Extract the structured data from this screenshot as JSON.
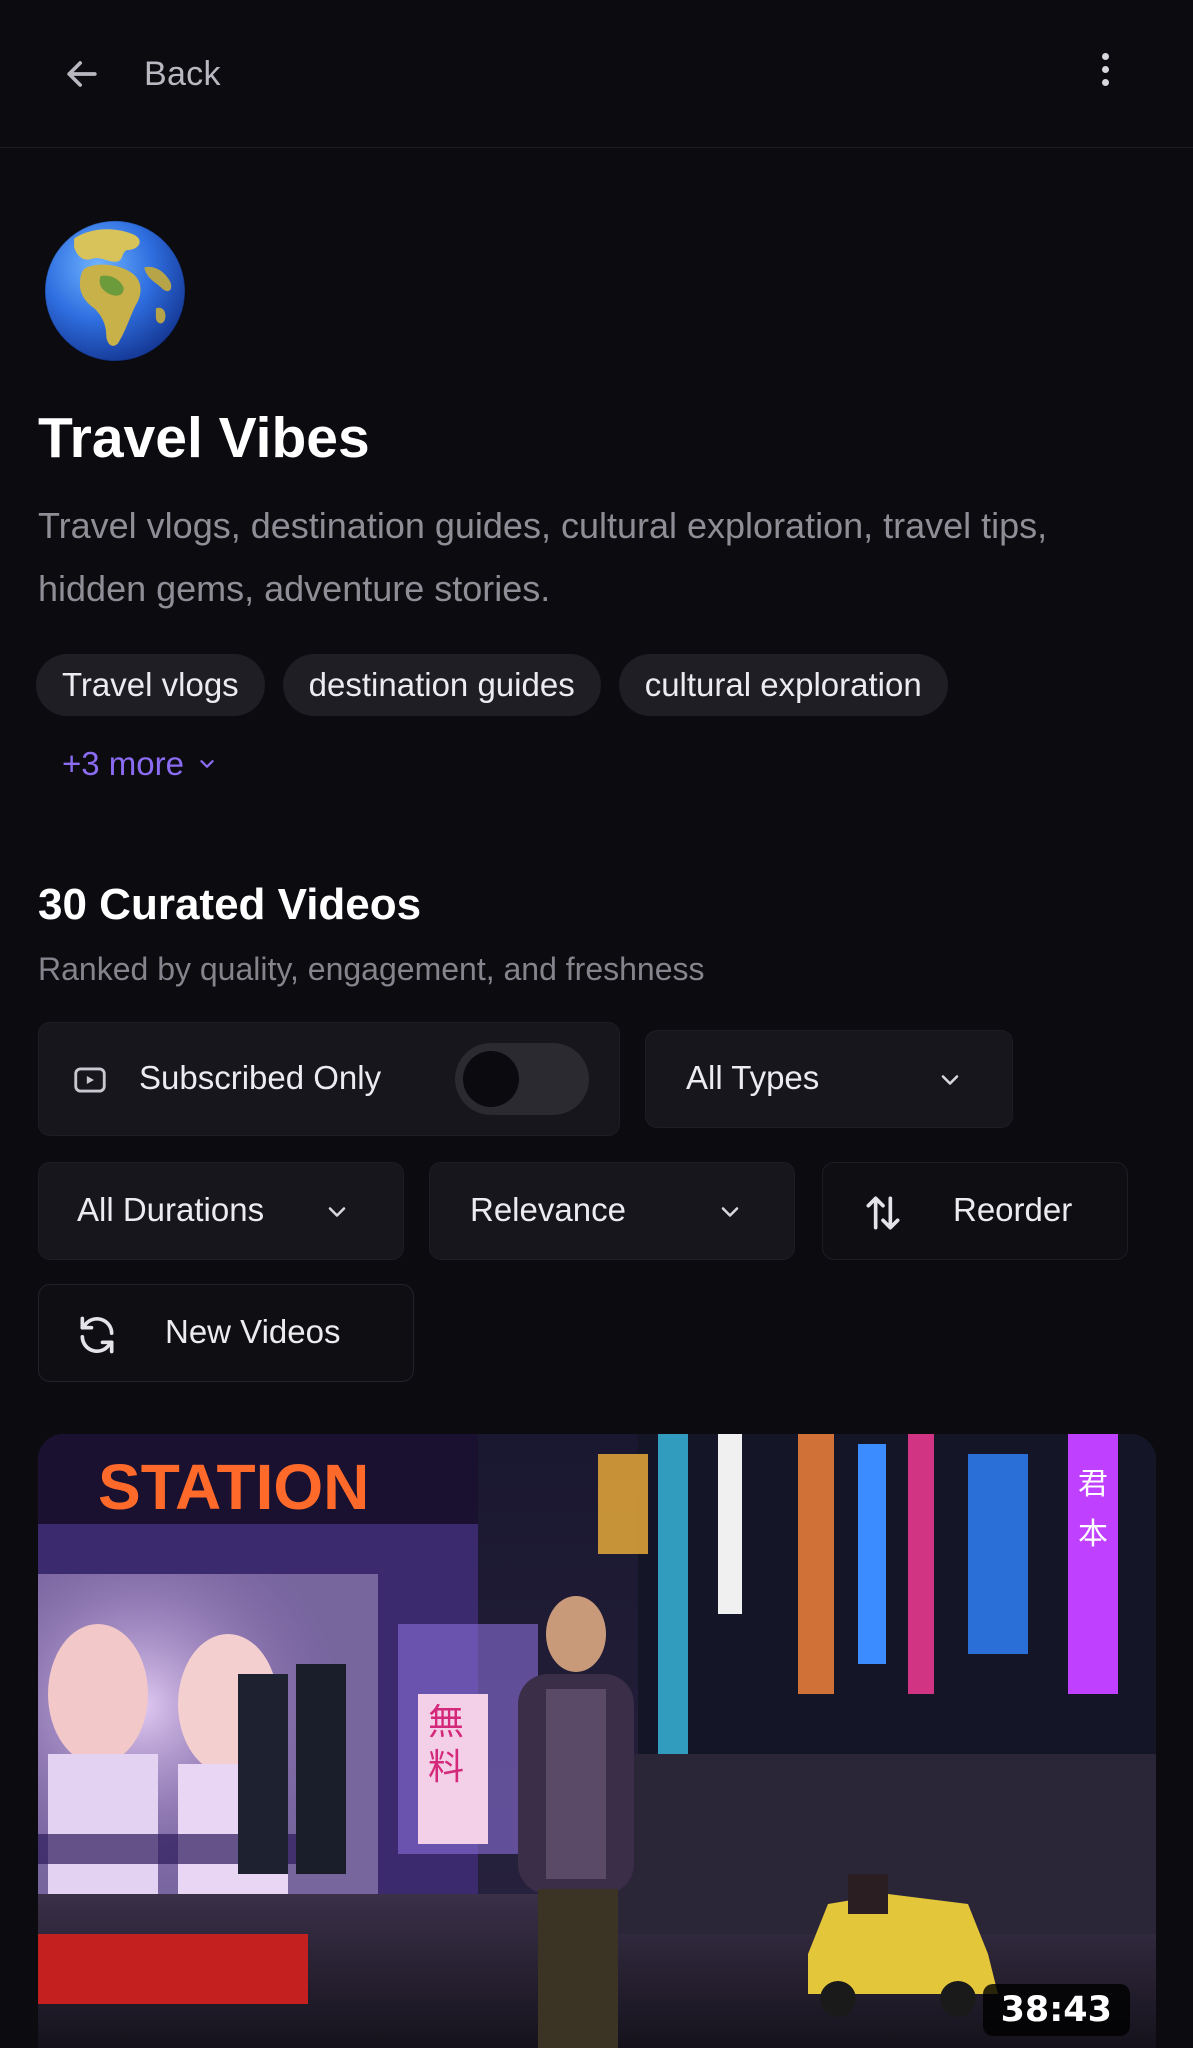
{
  "header": {
    "back_label": "Back"
  },
  "collection": {
    "icon": "globe-emoji",
    "title": "Travel Vibes",
    "description": "Travel vlogs, destination guides, cultural exploration, travel tips, hidden gems, adventure stories.",
    "tags": [
      "Travel vlogs",
      "destination guides",
      "cultural exploration"
    ],
    "more_tags_label": "+3 more"
  },
  "videos_section": {
    "title": "30 Curated Videos",
    "subtitle": "Ranked by quality, engagement, and freshness"
  },
  "filters": {
    "subscribed_only_label": "Subscribed Only",
    "subscribed_only_on": false,
    "type_select": "All Types",
    "duration_select": "All Durations",
    "sort_select": "Relevance",
    "reorder_label": "Reorder",
    "new_videos_label": "New Videos"
  },
  "video_list": [
    {
      "duration": "38:43"
    }
  ],
  "colors": {
    "background": "#0c0b10",
    "accent": "#8b6cf2",
    "control_bg": "#17161c"
  }
}
